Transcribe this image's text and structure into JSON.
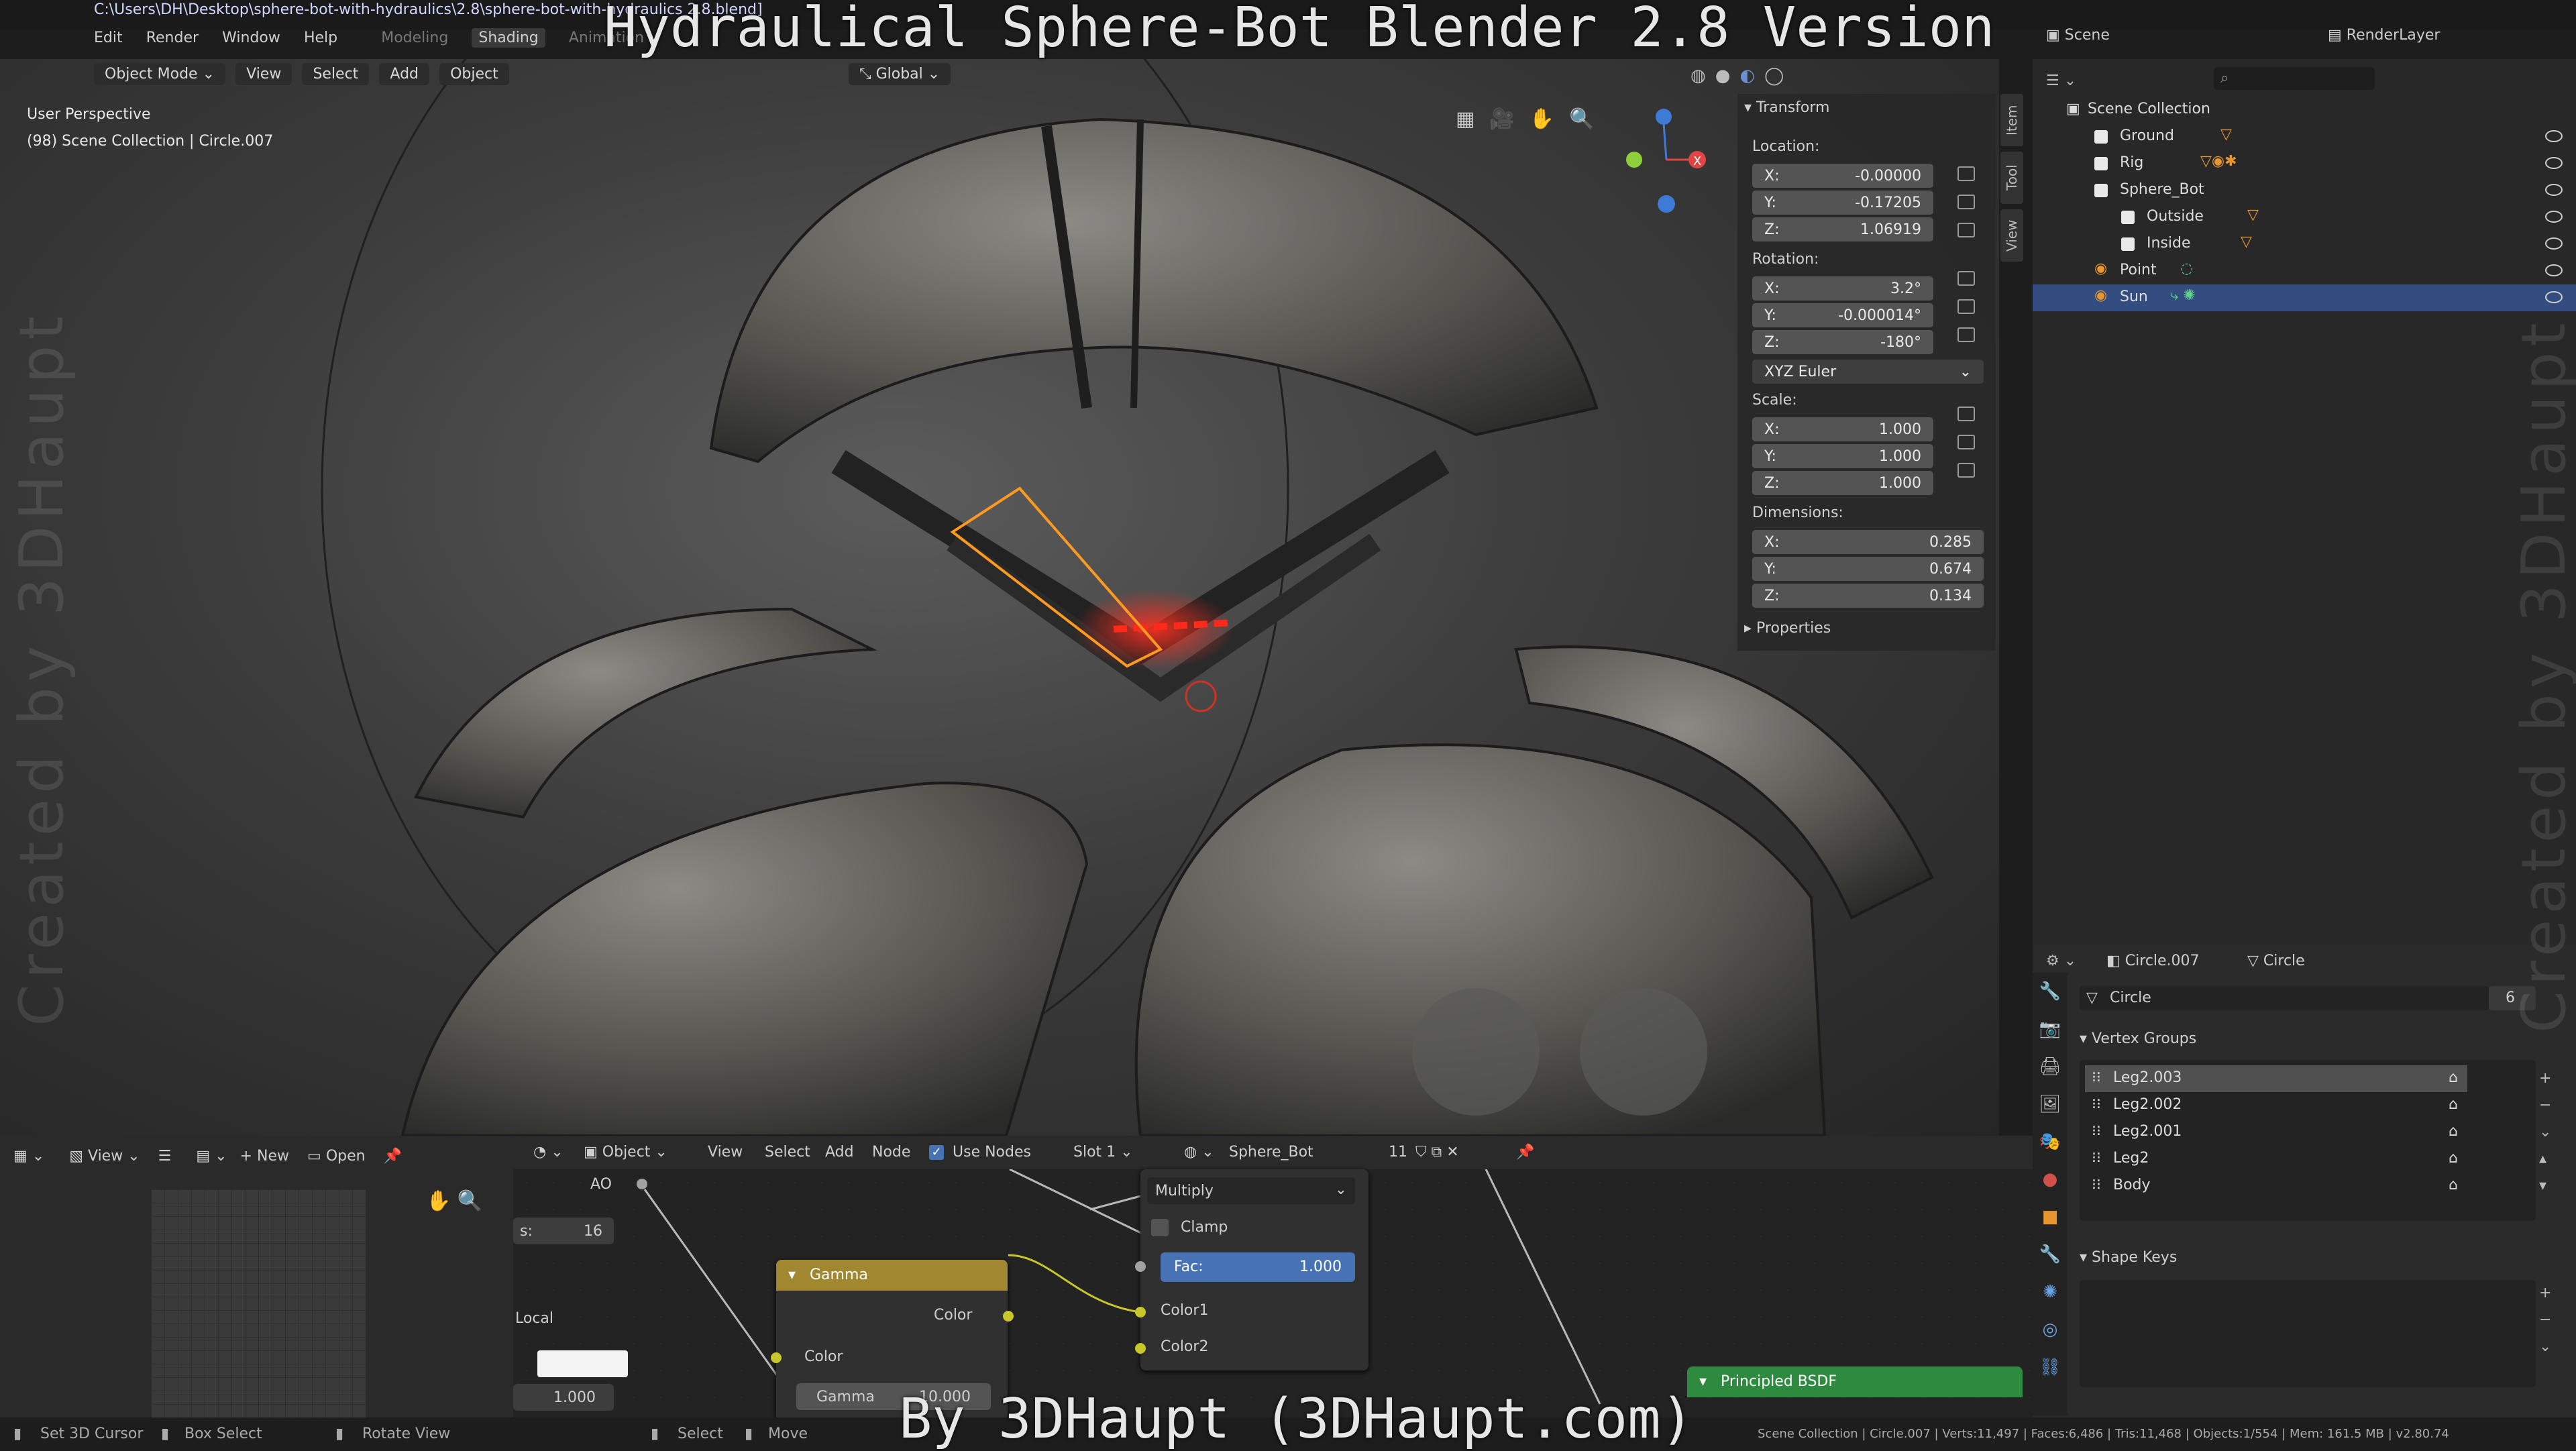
{
  "overlay": {
    "title": "Hydraulical Sphere-Bot Blender 2.8 Version",
    "credit": "By 3DHaupt (3DHaupt.com)",
    "watermark": "Created by 3DHaupt"
  },
  "window": {
    "filepath": "C:\\Users\\DH\\Desktop\\sphere-bot-with-hydraulics\\2.8\\sphere-bot-with-hydraulics 2.8.blend]"
  },
  "topmenu": [
    "Edit",
    "Render",
    "Window",
    "Help"
  ],
  "workspaces": [
    "Modeling",
    "Shading",
    "Animation"
  ],
  "scene_header": {
    "scene": "Scene",
    "layer": "RenderLayer"
  },
  "viewport": {
    "mode": "Object Mode",
    "menus": [
      "View",
      "Select",
      "Add",
      "Object"
    ],
    "orientation": "Global",
    "info_line1": "User Perspective",
    "info_line2": "(98) Scene Collection | Circle.007"
  },
  "npanel": {
    "transform_title": "Transform",
    "location_label": "Location:",
    "location": {
      "x": "-0.00000",
      "y": "-0.17205",
      "z": "1.06919"
    },
    "rotation_label": "Rotation:",
    "rotation": {
      "x": "3.2°",
      "y": "-0.000014°",
      "z": "-180°"
    },
    "rotation_mode": "XYZ Euler",
    "scale_label": "Scale:",
    "scale": {
      "x": "1.000",
      "y": "1.000",
      "z": "1.000"
    },
    "dimensions_label": "Dimensions:",
    "dimensions": {
      "x": "0.285",
      "y": "0.674",
      "z": "0.134"
    },
    "properties_title": "Properties",
    "axis": {
      "x": "X:",
      "y": "Y:",
      "z": "Z:"
    },
    "tabs": [
      "Item",
      "Tool",
      "View"
    ]
  },
  "outliner": {
    "root": "Scene Collection",
    "items": [
      {
        "label": "Ground"
      },
      {
        "label": "Rig"
      },
      {
        "label": "Sphere_Bot"
      },
      {
        "label": "Outside"
      },
      {
        "label": "Inside"
      },
      {
        "label": "Point"
      },
      {
        "label": "Sun"
      }
    ]
  },
  "properties": {
    "object": "Circle.007",
    "mesh": "Circle",
    "mesh_field": "Circle",
    "users": "6",
    "vertex_groups_title": "Vertex Groups",
    "vertex_groups": [
      "Leg2.003",
      "Leg2.002",
      "Leg2.001",
      "Leg2",
      "Body"
    ],
    "shape_keys_title": "Shape Keys"
  },
  "image_editor": {
    "view": "View",
    "new": "New",
    "open": "Open"
  },
  "node_editor": {
    "object": "Object",
    "menus": [
      "View",
      "Select",
      "Add",
      "Node"
    ],
    "use_nodes": "Use Nodes",
    "slot": "Slot 1",
    "material": "Sphere_Bot",
    "users": "11",
    "ao_label": "AO",
    "samples_label": "s:",
    "samples_value": "16",
    "local_label": "Local",
    "distance_value": "1.000",
    "gamma_node": {
      "title": "Gamma",
      "out": "Color",
      "in": "Color",
      "gamma_label": "Gamma",
      "gamma_value": "10.000"
    },
    "mix_node": {
      "blend": "Multiply",
      "clamp": "Clamp",
      "fac_label": "Fac:",
      "fac_value": "1.000",
      "color1": "Color1",
      "color2": "Color2"
    },
    "bsdf_title": "Principled BSDF"
  },
  "statusbar": {
    "left": [
      "Set 3D Cursor",
      "Box Select",
      "Rotate View",
      "Select",
      "Move"
    ],
    "right": "Scene Collection | Circle.007 | Verts:11,497 | Faces:6,486 | Tris:11,468 | Objects:1/554 | Mem: 161.5 MB | v2.80.74"
  },
  "colors": {
    "accent": "#334d80",
    "node_yellow": "#c7c729",
    "gamma_header": "#a08730",
    "bsdf_header": "#2e8a3e",
    "fac_blue": "#4772b3"
  }
}
